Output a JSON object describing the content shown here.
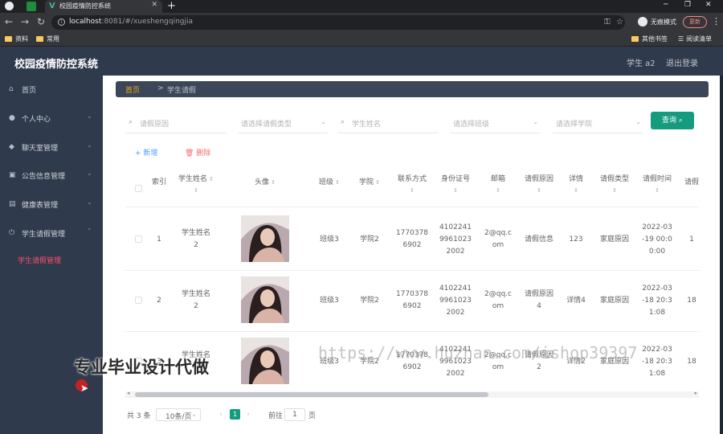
{
  "browser": {
    "tab_title": "校园疫情防控系统",
    "tab_favicon": "V",
    "url_host": "localhost",
    "url_rest": ":8081/#/xueshengqingjia",
    "incognito_label": "无痕模式",
    "update_label": "更新",
    "bookmarks": [
      "资料",
      "常用"
    ],
    "bookmarks_right": [
      "其他书签",
      "阅读清单"
    ]
  },
  "header": {
    "title": "校园疫情防控系统",
    "user": "学生 a2",
    "logout": "退出登录"
  },
  "sidebar": {
    "items": [
      {
        "label": "首页",
        "icon": "home-icon"
      },
      {
        "label": "个人中心",
        "icon": "user-icon"
      },
      {
        "label": "聊天室管理",
        "icon": "chat-icon"
      },
      {
        "label": "公告信息管理",
        "icon": "notice-icon"
      },
      {
        "label": "健康表管理",
        "icon": "health-icon"
      },
      {
        "label": "学生请假管理",
        "icon": "power-icon"
      }
    ],
    "active_sub": "学生请假管理"
  },
  "breadcrumb": {
    "home": "首页",
    "sep": ">",
    "current": "学生请假"
  },
  "filters": {
    "reason_placeholder": "请假原因",
    "type_placeholder": "请选择请假类型",
    "name_placeholder": "学生姓名",
    "class_placeholder": "请选择班级",
    "college_placeholder": "请选择学院",
    "query_label": "查询"
  },
  "actions": {
    "add": "新增",
    "delete": "删除"
  },
  "table": {
    "headers": [
      "索引",
      "学生姓名",
      "头像",
      "班级",
      "学院",
      "联系方式",
      "身份证号",
      "邮箱",
      "请假原因",
      "详情",
      "请假类型",
      "请假时间",
      "请假"
    ],
    "rows": [
      {
        "index": "1",
        "name": "学生姓名\n2",
        "cls": "班级3",
        "college": "学院2",
        "phone": "1770378\n6902",
        "idno": "4102241\n9961023\n2002",
        "email": "2@qq.c\nom",
        "reason": "请假信息",
        "detail": "123",
        "type": "家庭原因",
        "time": "2022-03\n-19 00:0\n0:00",
        "extra": "1"
      },
      {
        "index": "2",
        "name": "学生姓名\n2",
        "cls": "班级3",
        "college": "学院2",
        "phone": "1770378\n6902",
        "idno": "4102241\n9961023\n2002",
        "email": "2@qq.c\nom",
        "reason": "请假原因\n4",
        "detail": "详情4",
        "type": "家庭原因",
        "time": "2022-03\n-18 20:3\n1:08",
        "extra": "18"
      },
      {
        "index": "3",
        "name": "学生姓名\n2",
        "cls": "班级3",
        "college": "学院2",
        "phone": "1770378\n6902",
        "idno": "4102241\n9961023\n2002",
        "email": "2@qq.c\nom",
        "reason": "请假原因\n2",
        "detail": "详情2",
        "type": "家庭原因",
        "time": "2022-03\n-18 20:3\n1:08",
        "extra": "18"
      }
    ]
  },
  "pagination": {
    "total": "共 3 条",
    "page_size": "10条/页",
    "current": "1",
    "goto_prefix": "前往",
    "goto_value": "1",
    "goto_suffix": "页"
  },
  "watermarks": {
    "overlay_text": "专业毕业设计代做",
    "url_text": "https://www.huzhan.com/ishop39397"
  },
  "colors": {
    "accent": "#159b7e",
    "sidebar_bg": "#2f3a4c",
    "active_sub": "#ff4f6e",
    "breadcrumb_home": "#f5a623"
  }
}
